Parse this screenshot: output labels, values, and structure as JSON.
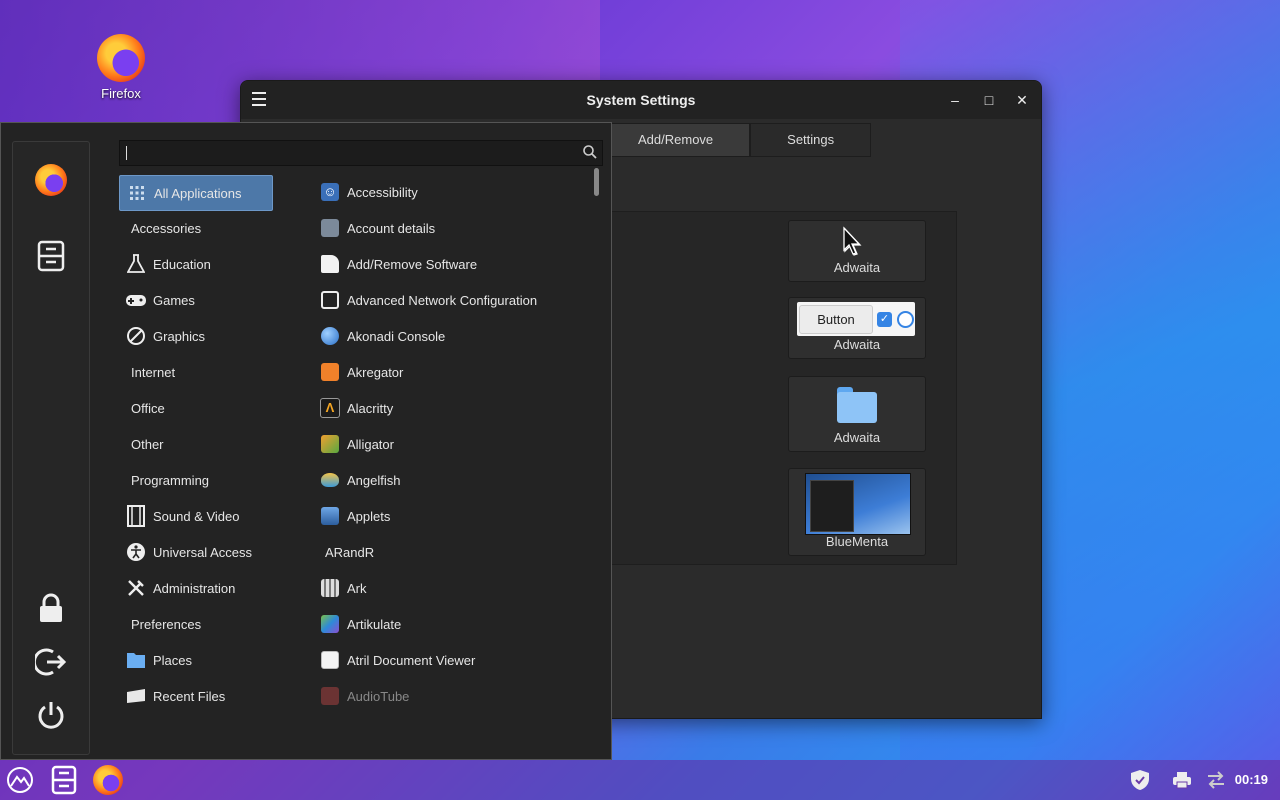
{
  "desktop": {
    "icons": [
      {
        "label": "Firefox",
        "icon": "firefox-icon"
      }
    ]
  },
  "settings_window": {
    "title": "System Settings",
    "tabs": [
      "Add/Remove",
      "Settings"
    ],
    "theme_cards": [
      {
        "name": "Adwaita",
        "preview": "cursor"
      },
      {
        "name": "Adwaita",
        "preview": "widgets",
        "button_label": "Button"
      },
      {
        "name": "Adwaita",
        "preview": "folder-icon"
      },
      {
        "name": "BlueMenta",
        "preview": "window-screenshot"
      }
    ]
  },
  "start_menu": {
    "search": {
      "value": "",
      "placeholder": ""
    },
    "sidebar": [
      "firefox-icon",
      "file-cabinet-icon",
      "lock-icon",
      "logout-icon",
      "power-icon"
    ],
    "categories": [
      {
        "label": "All Applications",
        "icon": "grid-icon",
        "selected": true
      },
      {
        "label": "Accessories",
        "icon": ""
      },
      {
        "label": "Education",
        "icon": "flask-icon"
      },
      {
        "label": "Games",
        "icon": "gamepad-icon"
      },
      {
        "label": "Graphics",
        "icon": "palette-icon"
      },
      {
        "label": "Internet",
        "icon": ""
      },
      {
        "label": "Office",
        "icon": ""
      },
      {
        "label": "Other",
        "icon": ""
      },
      {
        "label": "Programming",
        "icon": ""
      },
      {
        "label": "Sound & Video",
        "icon": "film-icon"
      },
      {
        "label": "Universal Access",
        "icon": "accessibility-icon"
      },
      {
        "label": "Administration",
        "icon": "tools-icon"
      },
      {
        "label": "Preferences",
        "icon": ""
      },
      {
        "label": "Places",
        "icon": "folder-icon"
      },
      {
        "label": "Recent Files",
        "icon": "recent-icon"
      }
    ],
    "apps": [
      {
        "label": "Accessibility",
        "icon": "accessibility-icon"
      },
      {
        "label": "Account details",
        "icon": "account-icon"
      },
      {
        "label": "Add/Remove Software",
        "icon": "package-icon"
      },
      {
        "label": "Advanced Network Configuration",
        "icon": "network-icon"
      },
      {
        "label": "Akonadi Console",
        "icon": "globe-icon"
      },
      {
        "label": "Akregator",
        "icon": "rss-icon"
      },
      {
        "label": "Alacritty",
        "icon": "alacritty-icon"
      },
      {
        "label": "Alligator",
        "icon": "alligator-icon"
      },
      {
        "label": "Angelfish",
        "icon": "angelfish-icon"
      },
      {
        "label": "Applets",
        "icon": "applets-icon"
      },
      {
        "label": "ARandR",
        "icon": ""
      },
      {
        "label": "Ark",
        "icon": "ark-icon"
      },
      {
        "label": "Artikulate",
        "icon": "artikulate-icon"
      },
      {
        "label": "Atril Document Viewer",
        "icon": "document-viewer-icon"
      },
      {
        "label": "AudioTube",
        "icon": "audiotube-icon"
      }
    ]
  },
  "taskbar": {
    "items": [
      "menu-launcher-icon",
      "file-cabinet-icon",
      "firefox-icon"
    ],
    "tray": [
      "shield-icon",
      "printer-icon",
      "network-transfer-icon"
    ],
    "clock": "00:19"
  }
}
